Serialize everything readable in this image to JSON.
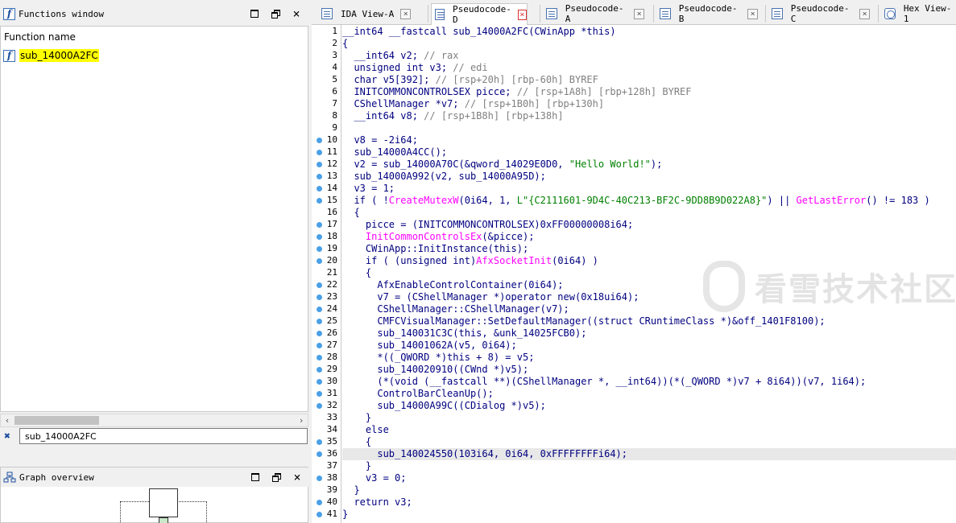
{
  "functions_window": {
    "title": "Functions window",
    "column_header": "Function name",
    "items": [
      {
        "name": "sub_14000A2FC"
      }
    ],
    "filter_value": "sub_14000A2FC"
  },
  "graph_overview": {
    "title": "Graph overview"
  },
  "window_buttons": {
    "minimize": "min",
    "restore": "restore",
    "close": "×"
  },
  "tabs": [
    {
      "label": "IDA View-A",
      "icon": "view-icon"
    },
    {
      "label": "Pseudocode-D",
      "icon": "pseudocode-icon",
      "active": true
    },
    {
      "label": "Pseudocode-A",
      "icon": "pseudocode-icon"
    },
    {
      "label": "Pseudocode-B",
      "icon": "pseudocode-icon"
    },
    {
      "label": "Pseudocode-C",
      "icon": "pseudocode-icon"
    },
    {
      "label": "Hex View-1",
      "icon": "hex-icon"
    }
  ],
  "watermark": {
    "text": "看雪技术社区"
  },
  "code": {
    "highlight_line": 36,
    "dot_lines": [
      10,
      11,
      12,
      13,
      14,
      15,
      17,
      18,
      19,
      20,
      22,
      23,
      24,
      25,
      26,
      27,
      28,
      29,
      30,
      31,
      32,
      35,
      36,
      38,
      40,
      41
    ],
    "lines": [
      {
        "n": 1,
        "t": "__int64 __fastcall sub_14000A2FC(CWinApp *this)"
      },
      {
        "n": 2,
        "t": "{"
      },
      {
        "n": 3,
        "t": "  __int64 v2; // rax"
      },
      {
        "n": 4,
        "t": "  unsigned int v3; // edi"
      },
      {
        "n": 5,
        "t": "  char v5[392]; // [rsp+20h] [rbp-60h] BYREF"
      },
      {
        "n": 6,
        "t": "  INITCOMMONCONTROLSEX picce; // [rsp+1A8h] [rbp+128h] BYREF"
      },
      {
        "n": 7,
        "t": "  CShellManager *v7; // [rsp+1B0h] [rbp+130h]"
      },
      {
        "n": 8,
        "t": "  __int64 v8; // [rsp+1B8h] [rbp+138h]"
      },
      {
        "n": 9,
        "t": ""
      },
      {
        "n": 10,
        "t": "  v8 = -2i64;"
      },
      {
        "n": 11,
        "t": "  sub_14000A4CC();"
      },
      {
        "n": 12,
        "t": "  v2 = sub_14000A70C(&qword_14029E0D0, \"Hello World!\");"
      },
      {
        "n": 13,
        "t": "  sub_14000A992(v2, sub_14000A95D);"
      },
      {
        "n": 14,
        "t": "  v3 = 1;"
      },
      {
        "n": 15,
        "t": "  if ( !CreateMutexW(0i64, 1, L\"{C2111601-9D4C-40C213-BF2C-9DD8B9D022A8}\") || GetLastError() != 183 )"
      },
      {
        "n": 16,
        "t": "  {"
      },
      {
        "n": 17,
        "t": "    picce = (INITCOMMONCONTROLSEX)0xFF00000008i64;"
      },
      {
        "n": 18,
        "t": "    InitCommonControlsEx(&picce);"
      },
      {
        "n": 19,
        "t": "    CWinApp::InitInstance(this);"
      },
      {
        "n": 20,
        "t": "    if ( (unsigned int)AfxSocketInit(0i64) )"
      },
      {
        "n": 21,
        "t": "    {"
      },
      {
        "n": 22,
        "t": "      AfxEnableControlContainer(0i64);"
      },
      {
        "n": 23,
        "t": "      v7 = (CShellManager *)operator new(0x18ui64);"
      },
      {
        "n": 24,
        "t": "      CShellManager::CShellManager(v7);"
      },
      {
        "n": 25,
        "t": "      CMFCVisualManager::SetDefaultManager((struct CRuntimeClass *)&off_1401F8100);"
      },
      {
        "n": 26,
        "t": "      sub_140031C3C(this, &unk_14025FCB0);"
      },
      {
        "n": 27,
        "t": "      sub_14001062A(v5, 0i64);"
      },
      {
        "n": 28,
        "t": "      *((_QWORD *)this + 8) = v5;"
      },
      {
        "n": 29,
        "t": "      sub_140020910((CWnd *)v5);"
      },
      {
        "n": 30,
        "t": "      (*(void (__fastcall **)(CShellManager *, __int64))(*(_QWORD *)v7 + 8i64))(v7, 1i64);"
      },
      {
        "n": 31,
        "t": "      ControlBarCleanUp();"
      },
      {
        "n": 32,
        "t": "      sub_14000A99C((CDialog *)v5);"
      },
      {
        "n": 33,
        "t": "    }"
      },
      {
        "n": 34,
        "t": "    else"
      },
      {
        "n": 35,
        "t": "    {"
      },
      {
        "n": 36,
        "t": "      sub_140024550(103i64, 0i64, 0xFFFFFFFFi64);"
      },
      {
        "n": 37,
        "t": "    }"
      },
      {
        "n": 38,
        "t": "    v3 = 0;"
      },
      {
        "n": 39,
        "t": "  }"
      },
      {
        "n": 40,
        "t": "  return v3;"
      },
      {
        "n": 41,
        "t": "}"
      }
    ]
  }
}
